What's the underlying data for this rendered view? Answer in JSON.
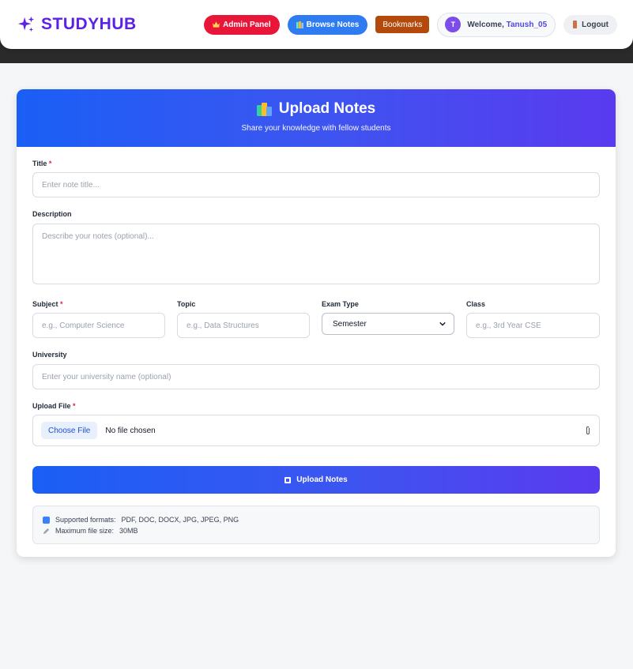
{
  "brand": {
    "name": "STUDYHUB",
    "icon": "sparkle-icon",
    "color": "#5b21e6"
  },
  "nav": {
    "admin_label": "Admin Panel",
    "browse_label": "Browse Notes",
    "bookmarks_label": "Bookmarks",
    "welcome_prefix": "Welcome,",
    "username": "Tanush_05",
    "avatar_initial": "T",
    "logout_label": "Logout"
  },
  "card": {
    "title": "Upload Notes",
    "subtitle": "Share your knowledge with fellow students",
    "accent": "#3d55f0"
  },
  "form": {
    "title": {
      "label": "Title",
      "required": "*",
      "placeholder": "Enter note title..."
    },
    "description": {
      "label": "Description",
      "placeholder": "Describe your notes (optional)..."
    },
    "subject": {
      "label": "Subject",
      "required": "*",
      "placeholder": "e.g., Computer Science"
    },
    "topic": {
      "label": "Topic",
      "placeholder": "e.g., Data Structures"
    },
    "exam_type": {
      "label": "Exam Type",
      "selected": "Semester"
    },
    "class_field": {
      "label": "Class",
      "placeholder": "e.g., 3rd Year CSE"
    },
    "university": {
      "label": "University",
      "placeholder": "Enter your university name (optional)"
    },
    "upload": {
      "label": "Upload File",
      "required": "*",
      "choose_label": "Choose File",
      "status": "No file chosen"
    },
    "submit_label": "Upload Notes"
  },
  "info": {
    "formats_label": "Supported formats:",
    "formats_value": "PDF, DOC, DOCX, JPG, JPEG, PNG",
    "size_label": "Maximum file size:",
    "size_value": "30MB"
  }
}
